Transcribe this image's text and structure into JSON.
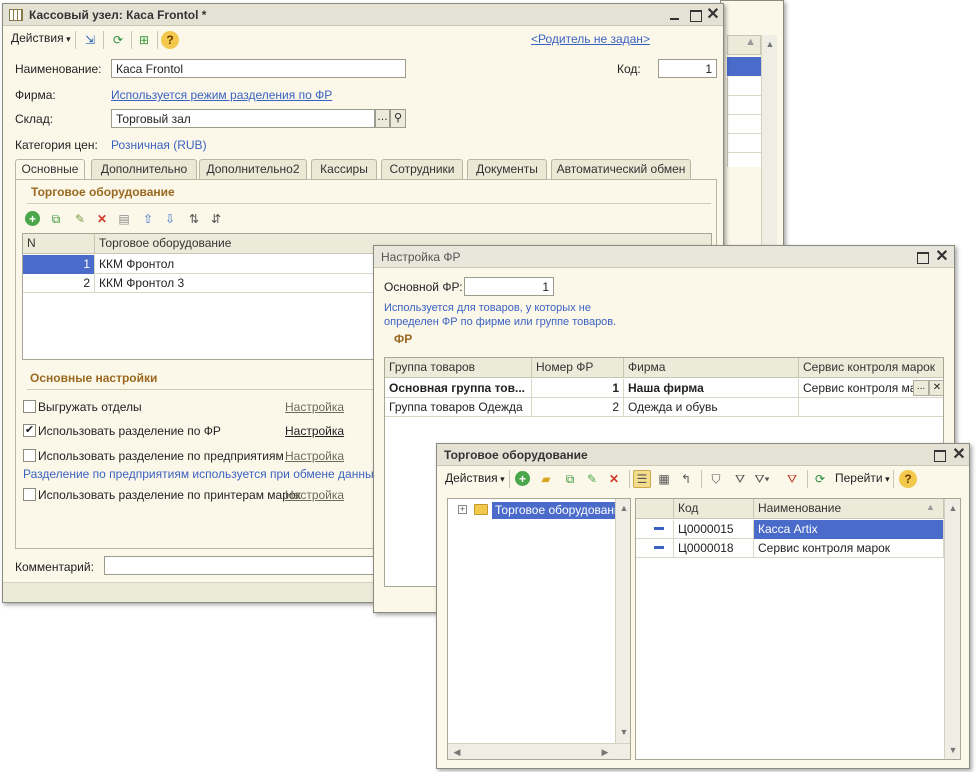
{
  "main_window": {
    "title": "Кассовый узел: Каса Frontol *",
    "actions_label": "Действия",
    "parent_link": "<Родитель не задан>",
    "name_label": "Наименование:",
    "name_value": "Каса Frontol",
    "code_label": "Код:",
    "code_value": "1",
    "firm_label": "Фирма:",
    "firm_value": "Используется режим разделения по ФР",
    "warehouse_label": "Склад:",
    "warehouse_value": "Торговый зал",
    "price_cat_label": "Категория цен:",
    "price_cat_value": "Розничная (RUB)",
    "tabs": [
      "Основные",
      "Дополнительно",
      "Дополнительно2",
      "Кассиры",
      "Сотрудники",
      "Документы",
      "Автоматический обмен"
    ],
    "equipment_section": "Торговое оборудование",
    "grid": {
      "columns": [
        "N",
        "Торговое оборудование"
      ],
      "rows": [
        {
          "n": "1",
          "name": "ККМ Фронтол"
        },
        {
          "n": "2",
          "name": "ККМ Фронтол 3"
        }
      ]
    },
    "basic_settings_section": "Основные настройки",
    "options": [
      {
        "label": "Выгружать отделы",
        "checked": false,
        "link": "Настройка"
      },
      {
        "label": "Использовать разделение по ФР",
        "checked": true,
        "link": "Настройка"
      },
      {
        "label": "Использовать разделение по предприятиям",
        "checked": false,
        "link": "Настройка"
      },
      {
        "label": "Использовать разделение по принтерам марок",
        "checked": false,
        "link": "Настройка"
      }
    ],
    "enterprise_note": "Разделение по предприятиям используется при обмене данными с с",
    "check_mark": "✔",
    "comment_label": "Комментарий:"
  },
  "fr_window": {
    "title": "Настройка ФР",
    "main_fr_label": "Основной ФР:",
    "main_fr_value": "1",
    "note_line1": "Используется для товаров, у которых не",
    "note_line2": "определен ФР по фирме или группе товаров.",
    "section": "ФР",
    "columns": [
      "Группа товаров",
      "Номер ФР",
      "Фирма",
      "Сервис контроля марок"
    ],
    "rows": [
      {
        "group": "Основная группа тов...",
        "num": "1",
        "firm": "Наша фирма",
        "service": "Сервис контроля мар"
      },
      {
        "group": "Группа товаров Одежда",
        "num": "2",
        "firm": "Одежда и обувь",
        "service": ""
      }
    ],
    "ellipsis": "...",
    "clear": "✕"
  },
  "equip_window": {
    "title": "Торговое оборудование",
    "actions_label": "Действия",
    "goto_label": "Перейти",
    "tree_root": "Торговое оборудование",
    "columns": [
      "Код",
      "Наименование"
    ],
    "rows": [
      {
        "code": "Ц0000015",
        "name": "Касса Artix"
      },
      {
        "code": "Ц0000018",
        "name": "Сервис контроля марок"
      }
    ]
  },
  "colors": {
    "window_bg": "#fbf8ea",
    "selection": "#4a6bc9",
    "link": "#3b62c0",
    "section_title": "#9a6820"
  }
}
